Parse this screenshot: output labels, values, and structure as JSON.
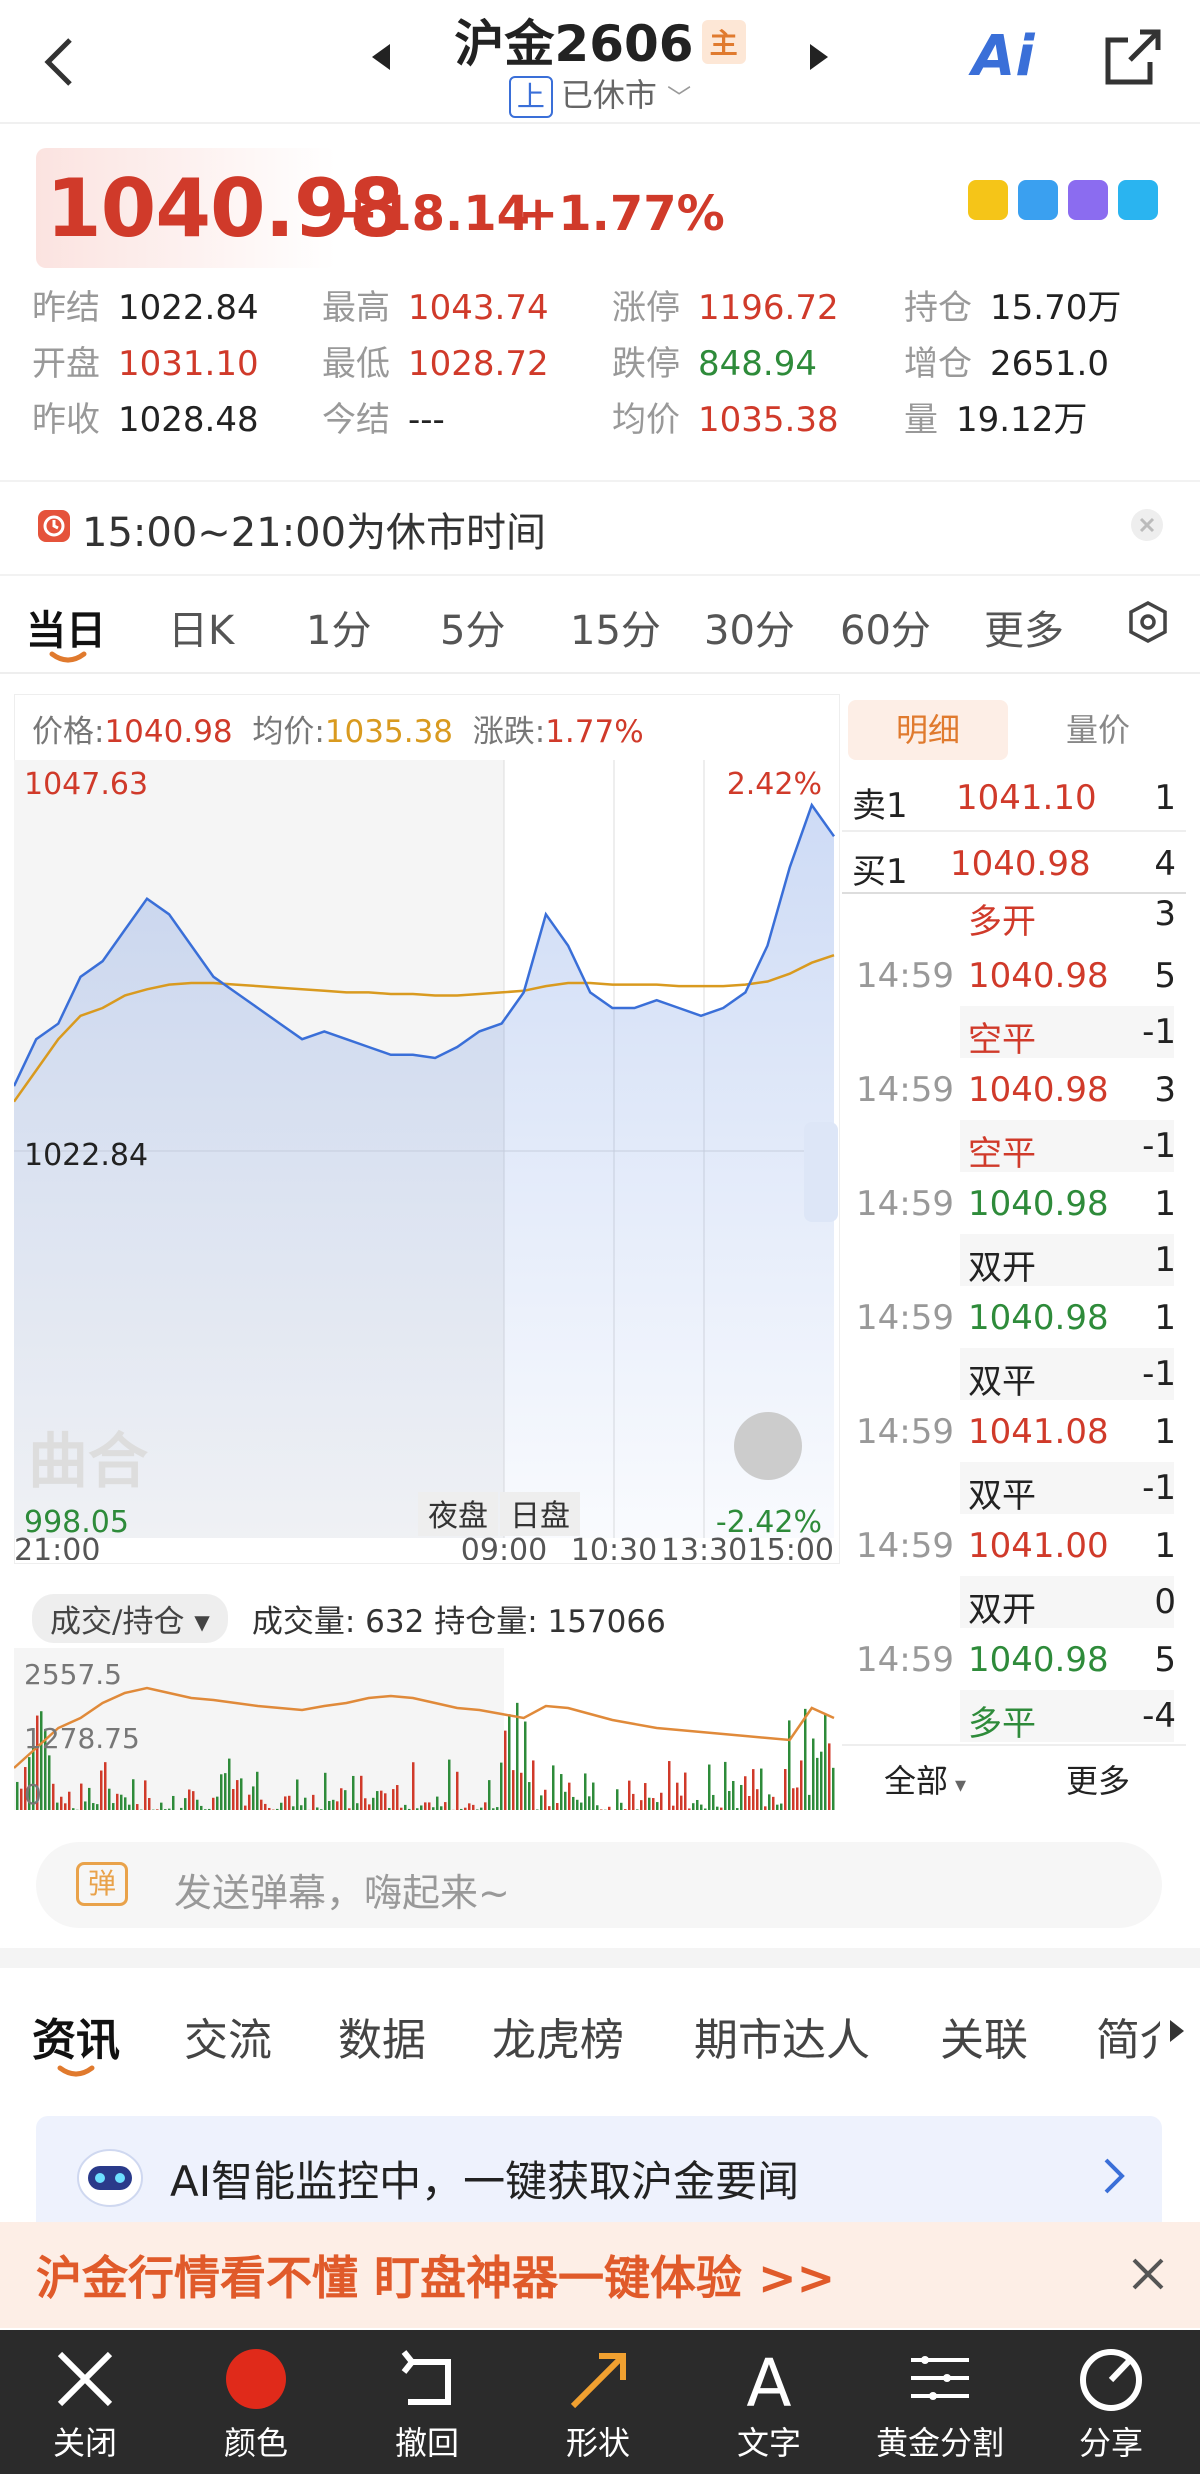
{
  "header": {
    "title": "沪金2606",
    "badge": "主",
    "exchange_tag": "上",
    "status": "已休市",
    "ai_label": "Ai"
  },
  "quote": {
    "price": "1040.98",
    "change": "+18.14",
    "change_pct": "+1.77%",
    "stats": [
      {
        "k": "昨结",
        "v": "1022.84",
        "c": "dark"
      },
      {
        "k": "最高",
        "v": "1043.74",
        "c": "red"
      },
      {
        "k": "涨停",
        "v": "1196.72",
        "c": "red"
      },
      {
        "k": "持仓",
        "v": "15.70万",
        "c": "dark"
      },
      {
        "k": "开盘",
        "v": "1031.10",
        "c": "red"
      },
      {
        "k": "最低",
        "v": "1028.72",
        "c": "red"
      },
      {
        "k": "跌停",
        "v": "848.94",
        "c": "green"
      },
      {
        "k": "增仓",
        "v": "2651.0",
        "c": "dark"
      },
      {
        "k": "昨收",
        "v": "1028.48",
        "c": "dark"
      },
      {
        "k": "今结",
        "v": "---",
        "c": "dark"
      },
      {
        "k": "均价",
        "v": "1035.38",
        "c": "red"
      },
      {
        "k": "量",
        "v": "19.12万",
        "c": "dark"
      }
    ]
  },
  "notice": {
    "text": "15:00~21:00为休市时间"
  },
  "period_tabs": [
    "当日",
    "日K",
    "1分",
    "5分",
    "15分",
    "30分",
    "60分",
    "更多"
  ],
  "chart_head": {
    "price_label": "价格:",
    "price": "1040.98",
    "avg_label": "均价:",
    "avg": "1035.38",
    "chg_label": "涨跌:",
    "chg": "1.77%"
  },
  "chart_data": {
    "type": "line",
    "y_max_label": "1047.63",
    "y_mid_label": "1022.84",
    "y_min_label": "998.05",
    "pct_max_label": "2.42%",
    "pct_min_label": "-2.42%",
    "x_ticks": [
      "21:00",
      "09:00",
      "10:30",
      "13:30",
      "15:00"
    ],
    "session_labels": [
      "夜盘",
      "日盘"
    ],
    "ylim": [
      998.05,
      1047.63
    ],
    "series": [
      {
        "values": [
          1027,
          1030,
          1031,
          1034,
          1035,
          1037,
          1039,
          1038,
          1036,
          1034,
          1033,
          1032,
          1031,
          1030,
          1030.5,
          1030,
          1029.5,
          1029,
          1029,
          1028.8,
          1029.5,
          1030.5,
          1031,
          1033,
          1038,
          1036,
          1033,
          1032,
          1032,
          1032.5,
          1032,
          1031.5,
          1032,
          1033,
          1036,
          1041,
          1045,
          1043
        ]
      },
      {
        "values": [
          1026,
          1028,
          1030,
          1031.5,
          1032,
          1032.8,
          1033.2,
          1033.5,
          1033.6,
          1033.6,
          1033.5,
          1033.4,
          1033.3,
          1033.2,
          1033.1,
          1033,
          1033,
          1032.9,
          1032.9,
          1032.8,
          1032.8,
          1032.9,
          1033,
          1033.1,
          1033.4,
          1033.6,
          1033.6,
          1033.5,
          1033.5,
          1033.5,
          1033.4,
          1033.4,
          1033.4,
          1033.5,
          1033.7,
          1034.2,
          1034.9,
          1035.38
        ]
      }
    ],
    "volume_max_label": "2557.5",
    "volume_mid_label": "1278.75",
    "volume_min_label": "0"
  },
  "volume_head": {
    "selector": "成交/持仓",
    "text": "成交量: 632 持仓量: 157066"
  },
  "watermark": "曲合",
  "detail": {
    "tabs": [
      "明细",
      "量价"
    ],
    "ask": {
      "label": "卖1",
      "price": "1041.10",
      "vol": "1"
    },
    "bid": {
      "label": "买1",
      "price": "1040.98",
      "vol": "4"
    },
    "top_partial": {
      "type": "多开",
      "vol": "3"
    },
    "rows": [
      {
        "time": "14:59",
        "price": "1040.98",
        "vol": "5",
        "type": "空平",
        "oi": "-1",
        "pc": "red",
        "tc": "red"
      },
      {
        "time": "14:59",
        "price": "1040.98",
        "vol": "3",
        "type": "空平",
        "oi": "-1",
        "pc": "red",
        "tc": "red"
      },
      {
        "time": "14:59",
        "price": "1040.98",
        "vol": "1",
        "type": "双开",
        "oi": "1",
        "pc": "green",
        "tc": "dark"
      },
      {
        "time": "14:59",
        "price": "1040.98",
        "vol": "1",
        "type": "双平",
        "oi": "-1",
        "pc": "green",
        "tc": "dark"
      },
      {
        "time": "14:59",
        "price": "1041.08",
        "vol": "1",
        "type": "双平",
        "oi": "-1",
        "pc": "red",
        "tc": "dark"
      },
      {
        "time": "14:59",
        "price": "1041.00",
        "vol": "1",
        "type": "双开",
        "oi": "0",
        "pc": "red",
        "tc": "dark"
      },
      {
        "time": "14:59",
        "price": "1040.98",
        "vol": "5",
        "type": "多平",
        "oi": "-4",
        "pc": "green",
        "tc": "green"
      }
    ],
    "filter": "全部",
    "more": "更多"
  },
  "danmu": {
    "icon": "弹",
    "placeholder": "发送弹幕，嗨起来~"
  },
  "news_tabs": [
    "资讯",
    "交流",
    "数据",
    "龙虎榜",
    "期市达人",
    "关联",
    "简介"
  ],
  "ai_bar": {
    "text": "AI智能监控中，一键获取沪金要闻"
  },
  "promo": {
    "text": "沪金行情看不懂  盯盘神器一键体验 >>"
  },
  "toolbar": [
    {
      "label": "关闭",
      "icon": "close-icon"
    },
    {
      "label": "颜色",
      "icon": "color-dot-icon"
    },
    {
      "label": "撤回",
      "icon": "undo-icon"
    },
    {
      "label": "形状",
      "icon": "arrow-icon"
    },
    {
      "label": "文字",
      "icon": "text-icon"
    },
    {
      "label": "黄金分割",
      "icon": "golden-ratio-icon"
    },
    {
      "label": "分享",
      "icon": "share-icon"
    }
  ],
  "colors": {
    "up": "#d03a2a",
    "down": "#2e8b3a",
    "avg": "#d99a1f",
    "price_line": "#3a6fd8"
  }
}
